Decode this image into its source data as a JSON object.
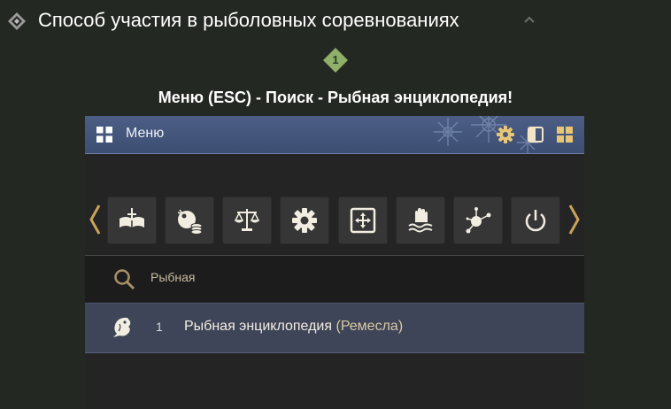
{
  "header": {
    "title": "Способ участия в рыболовных соревнованиях"
  },
  "step": {
    "number": "1"
  },
  "caption": "Меню (ESC) - Поиск - Рыбная энциклопедия!",
  "panel": {
    "title": "Меню",
    "toolbar_icons": [
      "gear-icon",
      "window-toggle-icon",
      "grid-icon"
    ],
    "menu_icons": [
      "book-sword-icon",
      "ball-coins-icon",
      "scales-icon",
      "gear-icon",
      "resize-icon",
      "hand-water-icon",
      "network-icon",
      "power-icon"
    ],
    "search": {
      "value": "Рыбная"
    },
    "results": [
      {
        "index": "1",
        "name": "Рыбная энциклопедия",
        "category": "(Ремесла)",
        "icon": "fish-icon"
      }
    ]
  },
  "colors": {
    "background": "#242822",
    "titlebar": "#46577d",
    "accent_green": "#8fb06a",
    "accent_gold": "#c9a25a",
    "result_row": "#3e4558"
  }
}
